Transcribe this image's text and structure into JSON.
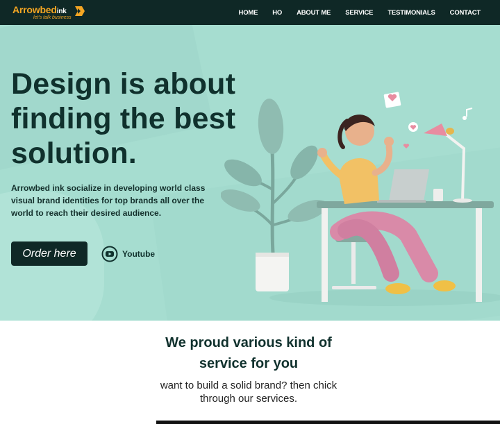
{
  "brand": {
    "name_part1": "Arrowbed",
    "name_part2": "ink",
    "tagline": "let's talk business",
    "accent": "#f5a623",
    "dark": "#0f2826"
  },
  "nav": {
    "items": [
      {
        "label": "HOME"
      },
      {
        "label": "HO"
      },
      {
        "label": "ABOUT ME"
      },
      {
        "label": "SERVICE"
      },
      {
        "label": "TESTIMONIALS"
      },
      {
        "label": "CONTACT"
      }
    ]
  },
  "hero": {
    "headline_line1": "Design is about",
    "headline_line2": "finding the best",
    "headline_line3": "solution.",
    "subtext": "Arrowbed ink socialize in developing world class visual brand identities for top brands all over the world to reach their desired audience.",
    "cta_label": "Order here",
    "youtube_label": "Youtube",
    "background": "#a6ddd0"
  },
  "services": {
    "title_line1": "We proud various kind of",
    "title_line2": "service for you",
    "subtitle_line1": "want to build a solid brand? then chick",
    "subtitle_line2": "through our services."
  }
}
